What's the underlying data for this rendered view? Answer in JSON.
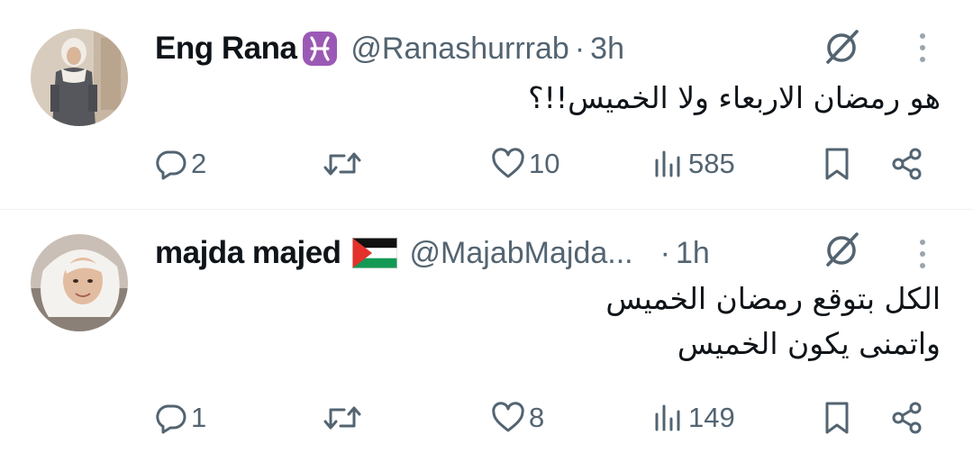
{
  "tweets": [
    {
      "name": "Eng Rana",
      "badge": "pisces-zodiac-badge",
      "handle": "@Ranashurrrab",
      "time": "3h",
      "text_lines": [
        "هو رمضان الاربعاء ولا الخميس!!؟"
      ],
      "replies": "2",
      "likes": "10",
      "views": "585"
    },
    {
      "name": "majda majed",
      "badge": "palestine-flag",
      "handle": "@MajabMajda...",
      "time": "1h",
      "text_lines": [
        "الكل بتوقع رمضان الخميس",
        "واتمنى يكون الخميس"
      ],
      "replies": "1",
      "likes": "8",
      "views": "149"
    }
  ],
  "separator": "·",
  "colors": {
    "text": "#0f1419",
    "secondary": "#536471",
    "divider": "#eff3f4",
    "badge": "#9b59b6"
  }
}
